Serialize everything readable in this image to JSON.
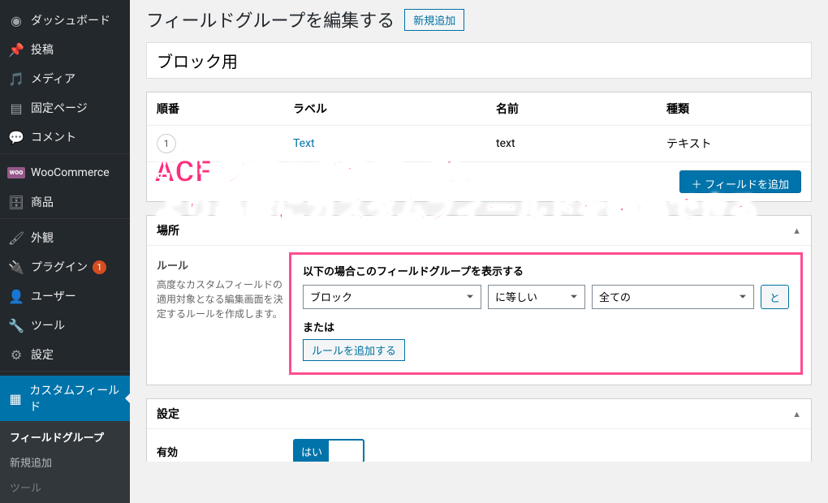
{
  "sidebar": {
    "items": [
      {
        "label": "ダッシュボード",
        "icon": "speed"
      },
      {
        "label": "投稿",
        "icon": "pin"
      },
      {
        "label": "メディア",
        "icon": "media"
      },
      {
        "label": "固定ページ",
        "icon": "page"
      },
      {
        "label": "コメント",
        "icon": "comment"
      },
      {
        "label": "WooCommerce",
        "icon": "woo"
      },
      {
        "label": "商品",
        "icon": "archive"
      },
      {
        "label": "外観",
        "icon": "brush"
      },
      {
        "label": "プラグイン",
        "icon": "plug",
        "badge": "1"
      },
      {
        "label": "ユーザー",
        "icon": "user"
      },
      {
        "label": "ツール",
        "icon": "wrench"
      },
      {
        "label": "設定",
        "icon": "gear"
      },
      {
        "label": "カスタムフィールド",
        "icon": "layout",
        "current": true
      }
    ],
    "submenu": [
      {
        "label": "フィールドグループ",
        "current": true
      },
      {
        "label": "新規追加"
      },
      {
        "label": "ツール"
      }
    ]
  },
  "header": {
    "title": "フィールドグループを編集する",
    "add_new": "新規追加"
  },
  "title_value": "ブロック用",
  "fields_table": {
    "headers": {
      "order": "順番",
      "label": "ラベル",
      "name": "名前",
      "type": "種類"
    },
    "rows": [
      {
        "order": "1",
        "label": "Text",
        "name": "text",
        "type": "テキスト"
      }
    ],
    "add_field": "＋ フィールドを追加"
  },
  "overlay": {
    "line1": "ACF ブロックを使って、",
    "line2": "より高度にカスタムフィールドを編集できる"
  },
  "location": {
    "panel_title": "場所",
    "rules_label": "ルール",
    "rules_desc": "高度なカスタムフィールドの適用対象となる編集画面を決定するルールを作成します。",
    "rules_heading": "以下の場合このフィールドグループを表示する",
    "param": "ブロック",
    "operator": "に等しい",
    "value": "全ての",
    "and_label": "と",
    "or_label": "または",
    "add_rule": "ルールを追加する"
  },
  "settings": {
    "panel_title": "設定",
    "active_label": "有効",
    "active_value": "はい"
  }
}
